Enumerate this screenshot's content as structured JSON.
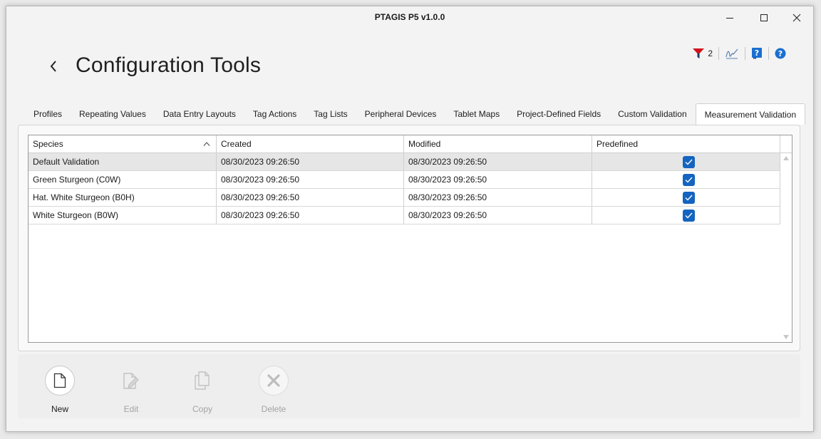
{
  "window": {
    "title": "PTAGIS P5 v1.0.0",
    "controls": {
      "minimize": "minimize-icon",
      "maximize": "maximize-icon",
      "close": "close-icon"
    }
  },
  "header": {
    "title": "Configuration Tools",
    "back_icon": "chevron-left-icon",
    "filter_count": "2",
    "icons": [
      "filter-icon",
      "signature-icon",
      "help-book-icon",
      "help-circle-icon"
    ]
  },
  "tabs": [
    {
      "label": "Profiles",
      "active": false
    },
    {
      "label": "Repeating Values",
      "active": false
    },
    {
      "label": "Data Entry Layouts",
      "active": false
    },
    {
      "label": "Tag Actions",
      "active": false
    },
    {
      "label": "Tag Lists",
      "active": false
    },
    {
      "label": "Peripheral Devices",
      "active": false
    },
    {
      "label": "Tablet Maps",
      "active": false
    },
    {
      "label": "Project-Defined Fields",
      "active": false
    },
    {
      "label": "Custom Validation",
      "active": false
    },
    {
      "label": "Measurement Validation",
      "active": true
    }
  ],
  "grid": {
    "columns": [
      "Species",
      "Created",
      "Modified",
      "Predefined"
    ],
    "sorted_column": "Species",
    "sort_direction": "ascending",
    "rows": [
      {
        "species": "Default Validation",
        "created": "08/30/2023 09:26:50",
        "modified": "08/30/2023 09:26:50",
        "predefined": true,
        "selected": true
      },
      {
        "species": "Green Sturgeon (C0W)",
        "created": "08/30/2023 09:26:50",
        "modified": "08/30/2023 09:26:50",
        "predefined": true,
        "selected": false
      },
      {
        "species": "Hat. White Sturgeon (B0H)",
        "created": "08/30/2023 09:26:50",
        "modified": "08/30/2023 09:26:50",
        "predefined": true,
        "selected": false
      },
      {
        "species": "White Sturgeon (B0W)",
        "created": "08/30/2023 09:26:50",
        "modified": "08/30/2023 09:26:50",
        "predefined": true,
        "selected": false
      }
    ]
  },
  "toolbar": {
    "new_label": "New",
    "edit_label": "Edit",
    "copy_label": "Copy",
    "delete_label": "Delete"
  },
  "colors": {
    "accent": "#1464c0",
    "filter_red": "#d0121b",
    "help_blue": "#1a6fd1",
    "disabled_text": "#a3a3a3"
  }
}
